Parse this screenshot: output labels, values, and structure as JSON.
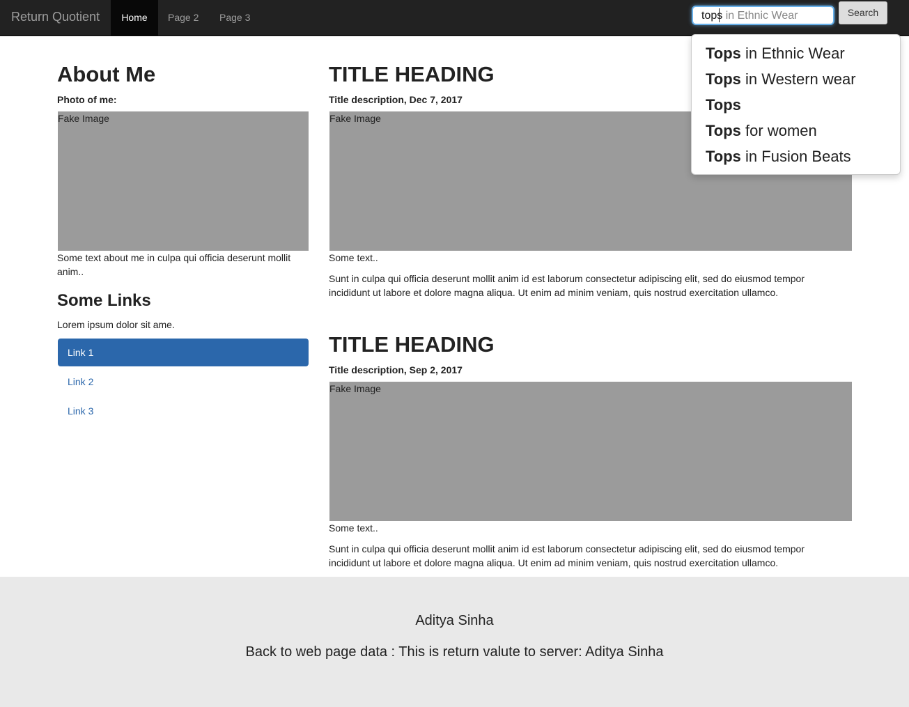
{
  "navbar": {
    "brand": "Return Quotient",
    "items": [
      "Home",
      "Page 2",
      "Page 3"
    ],
    "search": {
      "typed": "tops",
      "ghost": "tops in Ethnic Wear",
      "button": "Search"
    }
  },
  "suggestions": [
    {
      "bold": "Tops",
      "rest": " in Ethnic Wear"
    },
    {
      "bold": "Tops",
      "rest": " in Western wear"
    },
    {
      "bold": "Tops",
      "rest": ""
    },
    {
      "bold": "Tops",
      "rest": " for women"
    },
    {
      "bold": "Tops",
      "rest": " in Fusion Beats"
    }
  ],
  "sidebar": {
    "title": "About Me",
    "photo_label": "Photo of me:",
    "image_label": "Fake Image",
    "about_text": "Some text about me in culpa qui officia deserunt mollit anim..",
    "links_title": "Some Links",
    "links_intro": "Lorem ipsum dolor sit ame.",
    "links": [
      "Link 1",
      "Link 2",
      "Link 3"
    ]
  },
  "posts": [
    {
      "title": "TITLE HEADING",
      "description": "Title description, Dec 7, 2017",
      "image_label": "Fake Image",
      "short": "Some text..",
      "body": "Sunt in culpa qui officia deserunt mollit anim id est laborum consectetur adipiscing elit, sed do eiusmod tempor incididunt ut labore et dolore magna aliqua. Ut enim ad minim veniam, quis nostrud exercitation ullamco."
    },
    {
      "title": "TITLE HEADING",
      "description": "Title description, Sep 2, 2017",
      "image_label": "Fake Image",
      "short": "Some text..",
      "body": "Sunt in culpa qui officia deserunt mollit anim id est laborum consectetur adipiscing elit, sed do eiusmod tempor incididunt ut labore et dolore magna aliqua. Ut enim ad minim veniam, quis nostrud exercitation ullamco."
    }
  ],
  "footer": {
    "name": "Aditya Sinha",
    "message": "Back to web page data : This is return valute to server: Aditya Sinha"
  },
  "colors": {
    "navbar_bg": "#222222",
    "accent_blue": "#2b67ab",
    "image_gray": "#9b9b9b",
    "footer_bg": "#e9e9e9"
  }
}
